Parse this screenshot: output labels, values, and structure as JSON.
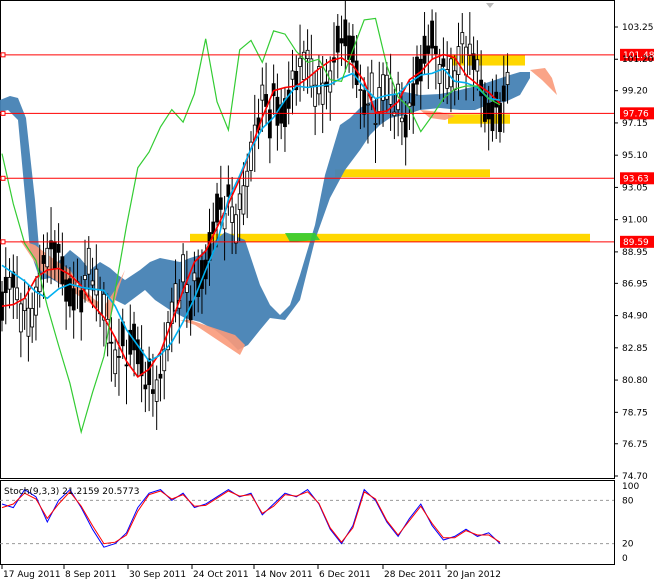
{
  "chart_data": [
    {
      "type": "candlestick",
      "title": "",
      "y_ticks": [
        "103.25",
        "101.20",
        "99.20",
        "97.15",
        "95.10",
        "93.05",
        "91.00",
        "88.95",
        "86.95",
        "84.90",
        "82.85",
        "80.80",
        "78.75",
        "76.75",
        "74.70"
      ],
      "ylim": [
        74.7,
        104.3
      ],
      "x_ticks": [
        "17 Aug 2011",
        "8 Sep 2011",
        "30 Sep 2011",
        "24 Oct 2011",
        "14 Nov 2011",
        "6 Dec 2011",
        "28 Dec 2011",
        "20 Jan 2012"
      ],
      "horizontal_lines": [
        {
          "label": "101.48",
          "value": 101.48,
          "color": "#ff0000"
        },
        {
          "label": "97.76",
          "value": 97.76,
          "color": "#ff0000"
        },
        {
          "label": "93.63",
          "value": 93.63,
          "color": "#ff0000"
        },
        {
          "label": "89.59",
          "value": 89.59,
          "color": "#ff0000"
        }
      ],
      "zones": [
        {
          "from_x": "30 Sep 2011",
          "to_x": "20 Jan 2012+",
          "low": 89.6,
          "high": 90.1,
          "color": "#ffd700"
        },
        {
          "from_x": "6 Dec 2011",
          "to_x": "20 Jan 2012",
          "low": 93.7,
          "high": 94.2,
          "color": "#ffd700"
        },
        {
          "from_x": "20 Jan 2012-",
          "to_x": "20 Jan 2012",
          "low": 97.1,
          "high": 97.7,
          "color": "#ffd700"
        },
        {
          "from_x": "20 Jan 2012-",
          "to_x": "20 Jan 2012+",
          "low": 100.8,
          "high": 101.5,
          "color": "#ffd700"
        }
      ],
      "series": [
        {
          "name": "",
          "color": "#ff0000",
          "values": [
            85.5,
            85.6,
            86.0,
            87.3,
            87.8,
            87.9,
            87.5,
            86.8,
            85.6,
            84.8,
            83.5,
            82.0,
            81.0,
            81.5,
            82.6,
            84.5,
            86.5,
            88.3,
            89.0,
            90.5,
            92.0,
            93.6,
            95.5,
            97.5,
            99.2,
            99.4,
            99.5,
            100.0,
            100.6,
            101.1,
            101.3,
            100.8,
            99.8,
            97.8,
            97.9,
            98.5,
            99.9,
            100.4,
            101.2,
            101.5,
            101.3,
            100.2,
            99.6,
            99.1,
            98.4
          ]
        },
        {
          "name": "",
          "color": "#00b0f0",
          "values": [
            88.1,
            87.6,
            87.1,
            86.4,
            86.0,
            86.6,
            86.9,
            86.7,
            86.6,
            86.5,
            85.5,
            84.0,
            83.0,
            82.0,
            82.4,
            83.2,
            84.5,
            86.0,
            87.8,
            89.5,
            92.3,
            93.8,
            95.5,
            96.8,
            97.5,
            98.6,
            99.5,
            99.4,
            99.5,
            99.6,
            100.0,
            100.3,
            99.4,
            98.7,
            98.9,
            99.0,
            99.7,
            100.2,
            100.3,
            100.6,
            99.8,
            99.7,
            99.4,
            98.7,
            98.6
          ]
        },
        {
          "name": "",
          "color": "#33cc33",
          "values": [
            95.2,
            92.0,
            89.5,
            88.4,
            85.5,
            83.0,
            80.6,
            77.5,
            80.0,
            82.3,
            86.5,
            90.6,
            94.3,
            95.3,
            96.9,
            98.0,
            97.2,
            99.0,
            102.5,
            98.5,
            96.7,
            101.8,
            102.4,
            101.0,
            103.0,
            102.8,
            101.7,
            101.0,
            101.2,
            99.9,
            99.8,
            101.8,
            103.7,
            103.8,
            100.8,
            98.8,
            98.1,
            96.6,
            97.6,
            98.7,
            99.3,
            99.5,
            99.5,
            98.7,
            98.3
          ]
        }
      ],
      "indicator": {
        "label": "Stoch(9,3,3) 21.2159 20.5773",
        "y_ticks": [
          "100",
          "80",
          "20",
          "0"
        ],
        "ylim": [
          0,
          100
        ],
        "levels": [
          80,
          20
        ],
        "series": [
          {
            "name": "",
            "color": "#0000ff",
            "values": [
              75,
              70,
              95,
              85,
              50,
              80,
              95,
              70,
              40,
              15,
              20,
              35,
              70,
              90,
              95,
              80,
              90,
              70,
              75,
              85,
              95,
              85,
              90,
              60,
              75,
              90,
              85,
              95,
              75,
              40,
              20,
              45,
              95,
              80,
              50,
              30,
              55,
              75,
              45,
              25,
              30,
              40,
              30,
              35,
              20
            ]
          },
          {
            "name": "",
            "color": "#ff0000",
            "values": [
              70,
              75,
              90,
              82,
              55,
              75,
              92,
              72,
              45,
              20,
              22,
              32,
              65,
              88,
              93,
              82,
              88,
              72,
              73,
              83,
              93,
              86,
              88,
              62,
              72,
              88,
              86,
              92,
              76,
              42,
              22,
              42,
              92,
              82,
              52,
              32,
              52,
              72,
              48,
              28,
              28,
              38,
              32,
              32,
              22
            ]
          }
        ]
      }
    }
  ]
}
